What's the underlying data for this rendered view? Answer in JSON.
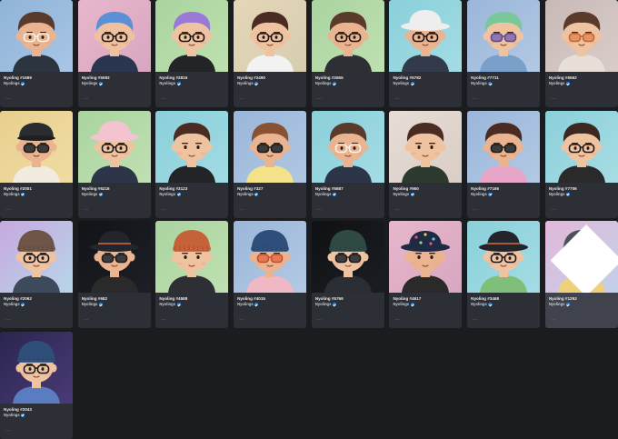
{
  "collection_label": "Nyolings",
  "more_label": "···",
  "items": [
    {
      "name": "Nyoling #1689",
      "bg": [
        "#8fb3d8",
        "#a9c6e6"
      ],
      "hair": "#5a3a2a",
      "hat": "none",
      "glasses": "white-frame",
      "skin": "#e9b48f",
      "shirt": "#2c3440"
    },
    {
      "name": "Nyoling #5083",
      "bg": [
        "#e7b7cc",
        "#d8a6c0"
      ],
      "hair": "#5b8fd6",
      "hat": "none",
      "glasses": "black-frame",
      "skin": "#efc19f",
      "shirt": "#2a3550"
    },
    {
      "name": "Nyoling #2816",
      "bg": [
        "#a9d49f",
        "#bfe0b0"
      ],
      "hair": "#9b7ad6",
      "hat": "none",
      "glasses": "black-frame",
      "skin": "#efc3a0",
      "shirt": "#222428"
    },
    {
      "name": "Nyoling #2490",
      "bg": [
        "#e4d7b8",
        "#d8ccb0"
      ],
      "hair": "#4a2c22",
      "hat": "none",
      "glasses": "black-frame",
      "skin": "#efc3a0",
      "shirt": "#f2f2f2"
    },
    {
      "name": "Nyoling #2655",
      "bg": [
        "#a9d49f",
        "#c0e0b1"
      ],
      "hair": "#5a3a2a",
      "hat": "none",
      "glasses": "black-frame",
      "skin": "#e9b48f",
      "shirt": "#2d2f34"
    },
    {
      "name": "Nyoling #5782",
      "bg": [
        "#8ad0da",
        "#a4dce4"
      ],
      "hair": "#5a3a2a",
      "hat": "bucket-white",
      "glasses": "black-frame",
      "skin": "#e9b48f",
      "shirt": "#333a4a"
    },
    {
      "name": "Nyoling #7711",
      "bg": [
        "#9ab6da",
        "#b3c9e4"
      ],
      "hair": "#7ac79a",
      "hat": "none",
      "glasses": "purple-lens",
      "skin": "#efc3a0",
      "shirt": "#7a9fc9"
    },
    {
      "name": "Nyoling #6562",
      "bg": [
        "#c8b9b6",
        "#d9cdca"
      ],
      "hair": "#5a3a2a",
      "hat": "none",
      "glasses": "star-frame",
      "skin": "#efc3a0",
      "shirt": "#e8e0d8"
    },
    {
      "name": "Nyoling #2001",
      "bg": [
        "#e8cf8f",
        "#f0dca3"
      ],
      "hair": "#5a3a2a",
      "hat": "cap-black",
      "glasses": "dark-lens",
      "skin": "#e9b48f",
      "shirt": "#f2ebe0"
    },
    {
      "name": "Nyoling #6216",
      "bg": [
        "#a9d49f",
        "#c1e0b3"
      ],
      "hair": "#5a3a2a",
      "hat": "bucket-pink",
      "glasses": "black-frame",
      "skin": "#efc3a0",
      "shirt": "#2d3548"
    },
    {
      "name": "Nyoling #3123",
      "bg": [
        "#8ad0da",
        "#a2dbe3"
      ],
      "hair": "#4a2c22",
      "hat": "none",
      "glasses": "none",
      "skin": "#efc3a0",
      "shirt": "#222428"
    },
    {
      "name": "Nyoling #327",
      "bg": [
        "#9ab6da",
        "#b0c7e3"
      ],
      "hair": "#8a5234",
      "hat": "none",
      "glasses": "dark-lens",
      "skin": "#e9b48f",
      "shirt": "#f3e28a"
    },
    {
      "name": "Nyoling #5687",
      "bg": [
        "#8ad0da",
        "#a4dce4"
      ],
      "hair": "#5a3a2a",
      "hat": "none",
      "glasses": "white-frame",
      "skin": "#e9b48f",
      "shirt": "#2d3548"
    },
    {
      "name": "Nyoling #950",
      "bg": [
        "#e7ddd6",
        "#d9cec6"
      ],
      "hair": "#4a2c22",
      "hat": "none",
      "glasses": "none",
      "skin": "#efc3a0",
      "shirt": "#2d3a30"
    },
    {
      "name": "Nyoling #7165",
      "bg": [
        "#9ab6da",
        "#b3c9e4"
      ],
      "hair": "#4a2c22",
      "hat": "none",
      "glasses": "dark-lens",
      "skin": "#e9b48f",
      "shirt": "#e7a6c8"
    },
    {
      "name": "Nyoling #7706",
      "bg": [
        "#8ad0da",
        "#a8dde4"
      ],
      "hair": "#3d2820",
      "hat": "none",
      "glasses": "black-frame",
      "skin": "#efc3a0",
      "shirt": "#2a2a2a"
    },
    {
      "name": "Nyoling #2062",
      "bg": [
        "#c7a8e0",
        "#b7d6e8"
      ],
      "hair": "#5a3a2a",
      "hat": "beanie-brown",
      "glasses": "black-frame",
      "skin": "#efc3a0",
      "shirt": "#3d4a5c"
    },
    {
      "name": "Nyoling #682",
      "bg": [
        "#111317",
        "#1c1f24"
      ],
      "hair": "#222",
      "hat": "bucket-black",
      "glasses": "dark-lens",
      "skin": "#e9b48f",
      "shirt": "#2a2a2a"
    },
    {
      "name": "Nyoling #4588",
      "bg": [
        "#a9d49f",
        "#c0e0b1"
      ],
      "hair": "#5a3a2a",
      "hat": "beanie-orange",
      "glasses": "none",
      "skin": "#efc3a0",
      "shirt": "#2d2f34"
    },
    {
      "name": "Nyoling #4015",
      "bg": [
        "#9ab6da",
        "#b3c9e4"
      ],
      "hair": "#5a3a2a",
      "hat": "beanie-navy",
      "glasses": "orange-lens",
      "skin": "#e9b48f",
      "shirt": "#f0b7c4"
    },
    {
      "name": "Nyoling #5769",
      "bg": [
        "#0f1114",
        "#1a1d22"
      ],
      "hair": "#222",
      "hat": "beanie-teal",
      "glasses": "dark-lens",
      "skin": "#efc3a0",
      "shirt": "#2a2e34"
    },
    {
      "name": "Nyoling #4617",
      "bg": [
        "#e7b7cc",
        "#d8a6c0"
      ],
      "hair": "#222",
      "hat": "bucket-floral",
      "glasses": "none",
      "skin": "#e9b48f",
      "shirt": "#2a2a2a"
    },
    {
      "name": "Nyoling #3468",
      "bg": [
        "#8ad0da",
        "#a4dce4"
      ],
      "hair": "#4a2c22",
      "hat": "bucket-black",
      "glasses": "black-frame",
      "skin": "#efc3a0",
      "shirt": "#7fbf7a"
    },
    {
      "name": "Nyoling #1293",
      "bg": [
        "#e2b8d8",
        "#c3d0ea"
      ],
      "hair": "#5a3a2a",
      "hat": "beanie-gray",
      "glasses": "hex-white",
      "skin": "#efc3a0",
      "shirt": "#f1d07a"
    },
    {
      "name": "Nyoling #2043",
      "bg": [
        "#2a2650",
        "#4a3a76"
      ],
      "hair": "#5a3a2a",
      "hat": "beanie-navy",
      "glasses": "black-frame",
      "skin": "#efc3a0",
      "shirt": "#5a7cc0"
    }
  ]
}
